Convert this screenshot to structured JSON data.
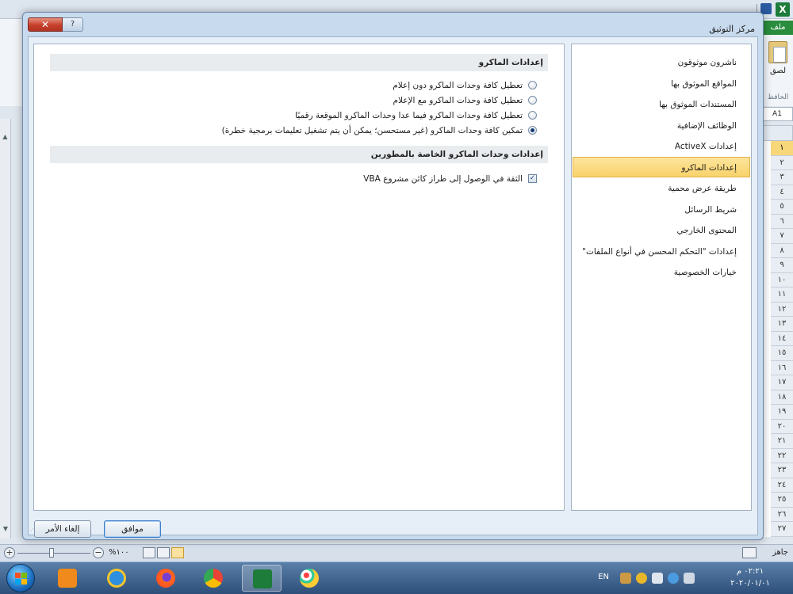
{
  "excel": {
    "logo": "X",
    "file_tab": "ملف",
    "paste_label": "لصق",
    "clipboard_group": "الحافظ",
    "name_box": "A1",
    "row_headers": [
      "١",
      "٢",
      "٣",
      "٤",
      "٥",
      "٦",
      "٧",
      "٨",
      "٩",
      "١٠",
      "١١",
      "١٢",
      "١٣",
      "١٤",
      "١٥",
      "١٦",
      "١٧",
      "١٨",
      "١٩",
      "٢٠",
      "٢١",
      "٢٢",
      "٢٣",
      "٢٤",
      "٢٥",
      "٢٦",
      "٢٧"
    ],
    "active_row": 0,
    "status": {
      "ready": "جاهز",
      "zoom": "%١٠٠"
    }
  },
  "dialog": {
    "title": "مركز التوثيق",
    "close_symbol": "✕",
    "help_symbol": "?",
    "nav_items": [
      "ناشرون موثوقون",
      "المواقع الموثوق بها",
      "المستندات الموثوق بها",
      "الوظائف الإضافية",
      "إعدادات ActiveX",
      "إعدادات الماكرو",
      "طريقة عرض محمية",
      "شريط الرسائل",
      "المحتوى الخارجي",
      "إعدادات \"التحكم المحسن في أنواع الملفات\"",
      "خيارات الخصوصية"
    ],
    "selected_nav": 5,
    "macro_section": {
      "title": "إعدادات الماكرو",
      "options": [
        "تعطيل كافة وحدات الماكرو دون إعلام",
        "تعطيل كافة وحدات الماكرو مع الإعلام",
        "تعطيل كافة وحدات الماكرو فيما عدا وحدات الماكرو الموقعة رقميًا",
        "تمكين كافة وحدات الماكرو (غير مستحسن؛ يمكن أن يتم تشغيل تعليمات برمجية خطرة)"
      ],
      "selected_option": 3
    },
    "developer_section": {
      "title": "إعدادات وحدات الماكرو الخاصة بالمطورين",
      "checkbox_label": "الثقة في الوصول إلى طراز كائن مشروع VBA",
      "checkbox_checked": true
    },
    "ok_label": "موافق",
    "cancel_label": "إلغاء الأمر"
  },
  "taskbar": {
    "apps": [
      "media-player-icon",
      "internet-explorer-icon",
      "firefox-icon",
      "chrome-icon",
      "excel-icon",
      "paint-icon"
    ],
    "active_app": 4,
    "language": "EN",
    "time": "٠٢:٢١ م",
    "date": "٢٠٢٠/٠١/٠١"
  }
}
